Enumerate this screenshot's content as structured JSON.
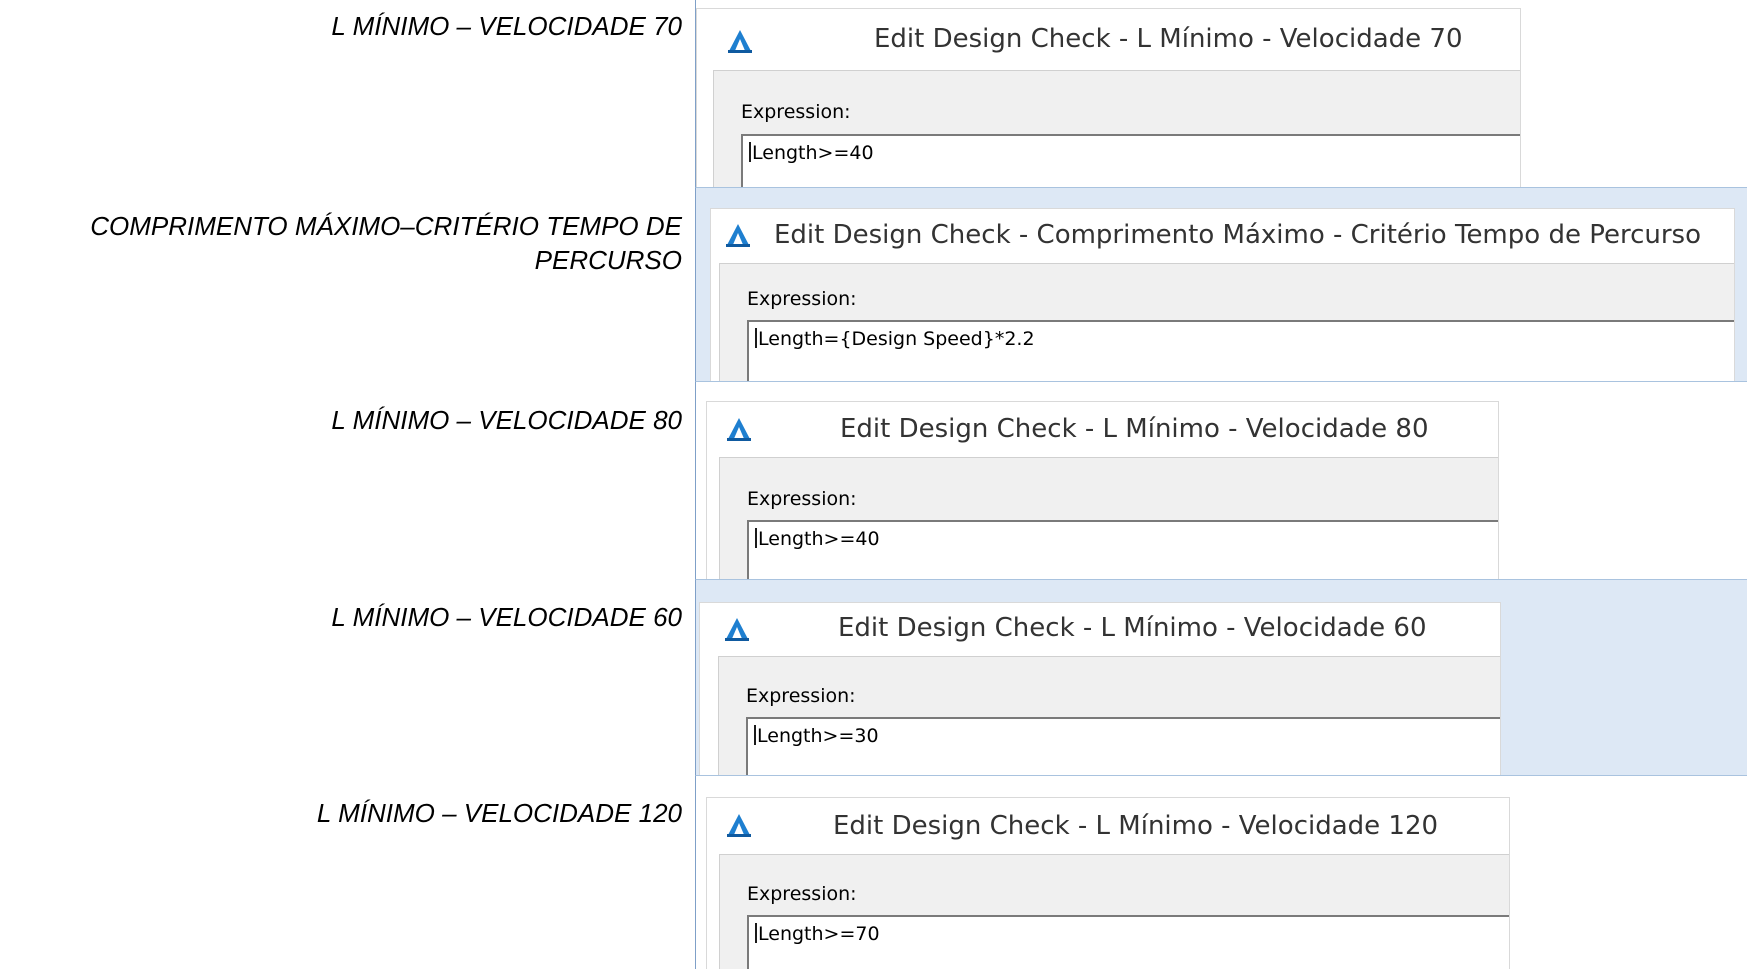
{
  "rows": [
    {
      "label": "L MÍNIMO – VELOCIDADE 70",
      "dialog_title": "Edit Design Check - L Mínimo - Velocidade 70",
      "expression_label": "Expression:",
      "expression_value": "Length>=40"
    },
    {
      "label": "COMPRIMENTO MÁXIMO–CRITÉRIO TEMPO DE PERCURSO",
      "dialog_title": "Edit Design Check - Comprimento Máximo - Critério Tempo de Percurso",
      "expression_label": "Expression:",
      "expression_value": "Length={Design Speed}*2.2"
    },
    {
      "label": "L MÍNIMO – VELOCIDADE 80",
      "dialog_title": "Edit Design Check - L Mínimo - Velocidade 80",
      "expression_label": "Expression:",
      "expression_value": "Length>=40"
    },
    {
      "label": "L MÍNIMO – VELOCIDADE 60",
      "dialog_title": "Edit Design Check - L Mínimo - Velocidade 60",
      "expression_label": "Expression:",
      "expression_value": "Length>=30"
    },
    {
      "label": "L MÍNIMO – VELOCIDADE 120",
      "dialog_title": "Edit Design Check - L Mínimo - Velocidade 120",
      "expression_label": "Expression:",
      "expression_value": "Length>=70"
    }
  ],
  "colors": {
    "cell_tint": "#dde8f5",
    "grid_line": "#7fa0c8",
    "icon_accent": "#1e7fd0",
    "dialog_body": "#f0f0f0"
  },
  "icons": {
    "app_icon": "autodesk-civil-3d-icon"
  }
}
